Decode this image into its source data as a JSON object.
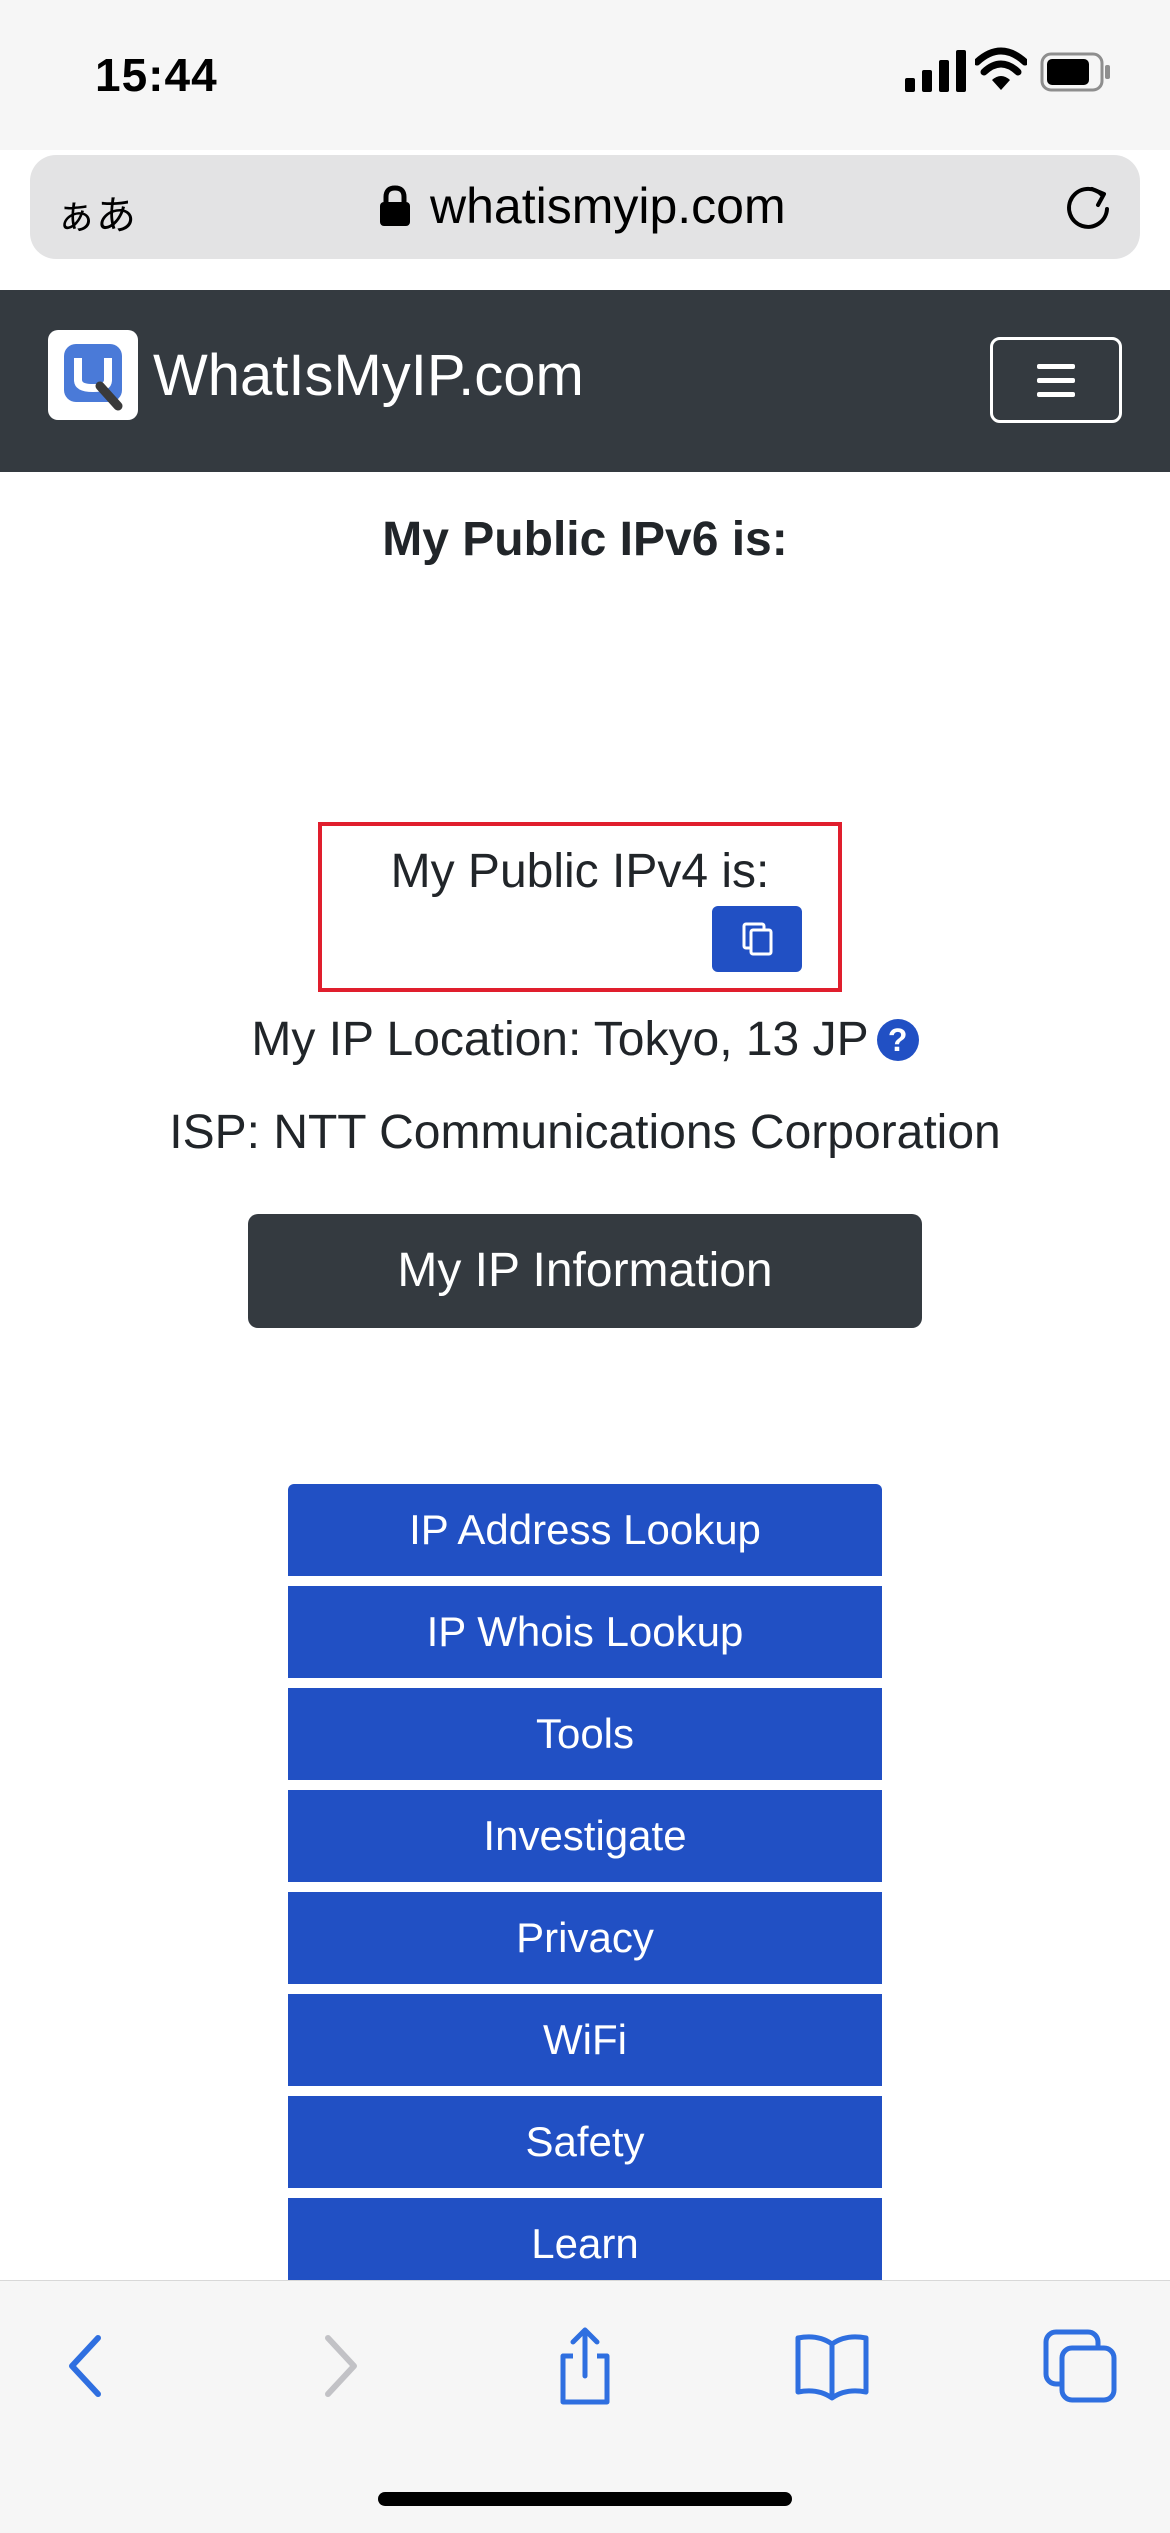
{
  "status_bar": {
    "time": "15:44"
  },
  "browser": {
    "aa_label": "ぁあ",
    "url": "whatismyip.com"
  },
  "site_nav": {
    "brand": "WhatIsMyIP.com"
  },
  "main": {
    "ipv6_label": "My Public IPv6 is:",
    "ipv4_label": "My Public IPv4 is:",
    "location_text": "My IP Location: Tokyo, 13 JP",
    "help_glyph": "?",
    "isp_text": "ISP: NTT Communications Corporation",
    "info_button": "My IP Information"
  },
  "menu": {
    "items": [
      {
        "label": "IP Address Lookup"
      },
      {
        "label": "IP Whois Lookup"
      },
      {
        "label": "Tools"
      },
      {
        "label": "Investigate"
      },
      {
        "label": "Privacy"
      },
      {
        "label": "WiFi"
      },
      {
        "label": "Safety"
      },
      {
        "label": "Learn"
      }
    ]
  },
  "colors": {
    "accent": "#2150c4",
    "dark": "#343a40",
    "highlight": "#e01e2d"
  },
  "icons": {
    "toolbar": [
      "back-icon",
      "forward-icon",
      "share-icon",
      "bookmarks-icon",
      "tabs-icon"
    ]
  }
}
